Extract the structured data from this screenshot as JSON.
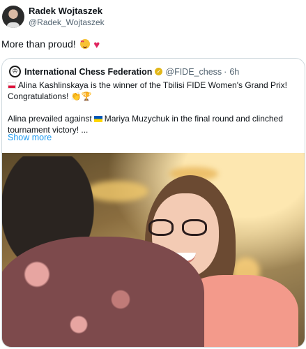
{
  "tweet": {
    "author_name": "Radek Wojtaszek",
    "author_handle": "@Radek_Wojtaszek",
    "text": "More than proud!",
    "emojis": [
      "smiling-face-with-heart-eyes",
      "red-heart"
    ]
  },
  "quoted": {
    "account_name": "International Chess Federation",
    "handle": "@FIDE_chess",
    "separator": "·",
    "time": "6h",
    "line1": "Alina Kashlinskaya is the winner of the Tbilisi FIDE Women's Grand Prix!",
    "line2": "Congratulations!",
    "line3a": "Alina prevailed against",
    "line3b": "Mariya Muzychuk in the final round and clinched",
    "line4": "tournament victory! ...",
    "show_more": "Show more",
    "icons": [
      "fide-logo-icon",
      "verified-badge-icon",
      "poland-flag-icon",
      "clapping-hands-icon",
      "trophy-icon",
      "ukraine-flag-icon"
    ],
    "colors": {
      "link": "#1d9bf0",
      "muted": "#536471",
      "verified": "#e2b719"
    }
  }
}
